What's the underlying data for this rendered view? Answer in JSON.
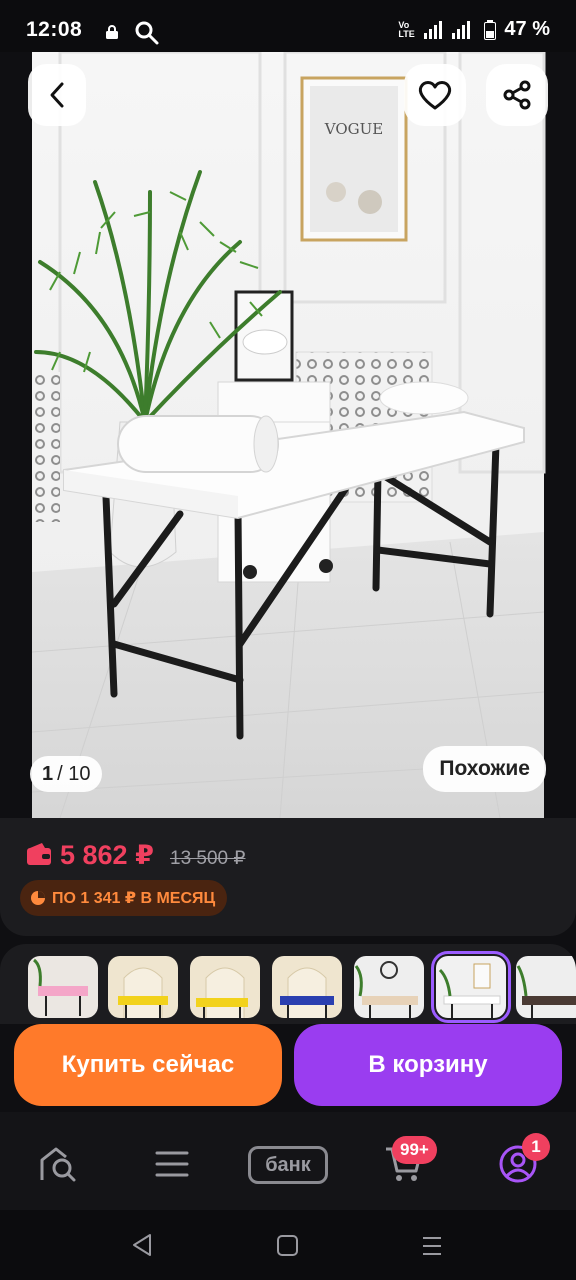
{
  "status_bar": {
    "time": "12:08",
    "battery": "47 %",
    "net_label": "Vo LTE"
  },
  "photo": {
    "counter_current": "1",
    "counter_total": "/ 10",
    "similar_label": "Похожие",
    "mirror_text": "VOGUE"
  },
  "price": {
    "current": "5 862 ₽",
    "old": "13 500 ₽",
    "installment": "ПО 1 341 ₽ В МЕСЯЦ",
    "accent_color": "#f0405f"
  },
  "thumbnails": [
    {
      "color": "#f4a6c8"
    },
    {
      "color": "#f2d21c"
    },
    {
      "color": "#f2d21c"
    },
    {
      "color": "#2a3fb0"
    },
    {
      "color": "#e7d2b8"
    },
    {
      "color": "#ffffff",
      "selected": true
    },
    {
      "color": "#4a3a33"
    }
  ],
  "actions": {
    "buy_now": "Купить сейчас",
    "add_to_cart": "В корзину"
  },
  "tabbar": {
    "bank_label": "банк",
    "cart_badge": "99+",
    "profile_badge": "1"
  },
  "icons": [
    "back-icon",
    "heart-icon",
    "share-icon",
    "wallet-icon",
    "home-search-icon",
    "menu-icon",
    "cart-icon",
    "profile-icon"
  ]
}
